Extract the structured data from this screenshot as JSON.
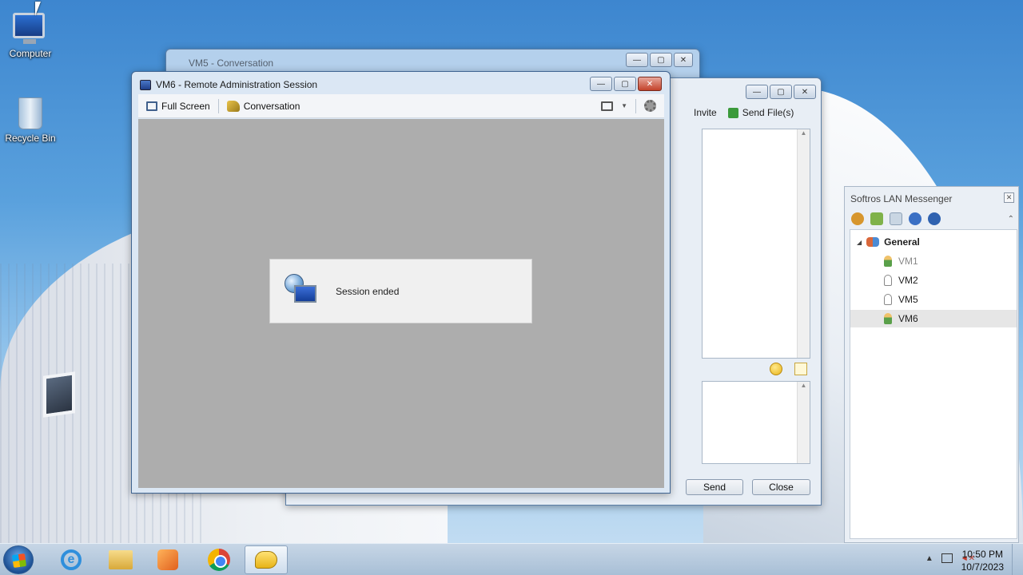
{
  "desktop": {
    "icons": [
      {
        "label": "Computer"
      },
      {
        "label": "Recycle Bin"
      }
    ]
  },
  "vm5_window": {
    "title": "VM5 - Conversation"
  },
  "conversation_window": {
    "toolbar": {
      "invite": "Invite",
      "send_files": "Send File(s)"
    },
    "buttons": {
      "send": "Send",
      "close": "Close"
    }
  },
  "vm6_window": {
    "title": "VM6 - Remote Administration Session",
    "toolbar": {
      "full_screen": "Full Screen",
      "conversation": "Conversation"
    },
    "session_message": "Session ended"
  },
  "softros": {
    "title": "Softros LAN Messenger",
    "group": "General",
    "users": [
      {
        "name": "VM1",
        "status": "online",
        "dim": true
      },
      {
        "name": "VM2",
        "status": "offline"
      },
      {
        "name": "VM5",
        "status": "offline"
      },
      {
        "name": "VM6",
        "status": "online",
        "selected": true
      }
    ]
  },
  "taskbar": {
    "pinned": [
      "internet-explorer",
      "windows-explorer",
      "media-player",
      "chrome",
      "softros-messenger"
    ],
    "active": "softros-messenger",
    "clock_time": "10:50 PM",
    "clock_date": "10/7/2023"
  },
  "colors": {
    "accent": "#3f6491",
    "canvas": "#adadad",
    "desktop": "#3d86cf"
  }
}
